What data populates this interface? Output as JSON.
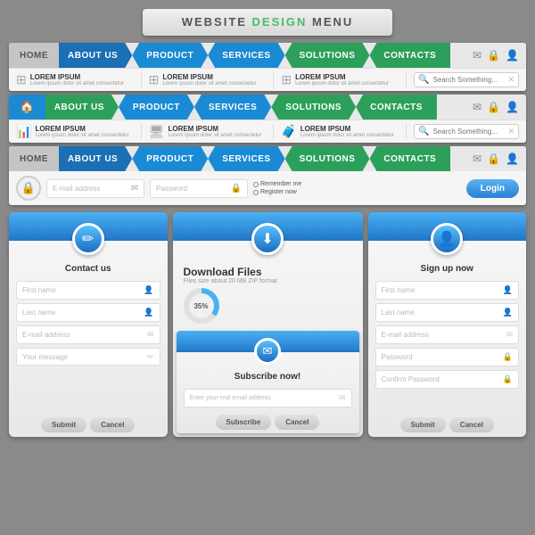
{
  "page": {
    "title_part1": "WEBSITE ",
    "title_part2": "DESIGN",
    "title_part3": " MENU"
  },
  "nav1": {
    "home": "HOME",
    "about": "ABOUT US",
    "product": "PRODUCT",
    "services": "SERVICES",
    "solutions": "SOLUTIONS",
    "contacts": "CONTACTS"
  },
  "nav2": {
    "about": "ABOUT US",
    "product": "PRODUCT",
    "services": "SERVICES",
    "solutions": "SOLUTIONS",
    "contacts": "CONTACTS"
  },
  "nav3": {
    "home": "HOME",
    "about": "ABOUT US",
    "product": "PRODUCT",
    "services": "SERVICES",
    "solutions": "SOLUTIONS",
    "contacts": "CONTACTS"
  },
  "content": {
    "lorem1": "LOREM IPSUM",
    "lorem2": "LOREM IPSUM",
    "lorem3": "LOREM IPSUM",
    "lorem_sub": "Lorem ipsum dolor sit amet consectetur",
    "search_placeholder": "Search Something..."
  },
  "login": {
    "email_placeholder": "E-mail address",
    "password_placeholder": "Password",
    "remember": "Remember me",
    "register": "Register now",
    "btn": "Login"
  },
  "contact_panel": {
    "title": "Contact us",
    "icon": "✏",
    "fields": [
      "First name",
      "Last name",
      "E-mail address",
      "Your message"
    ],
    "submit": "Submit",
    "cancel": "Cancel"
  },
  "download_panel": {
    "title": "Download Files",
    "subtitle": "Files size about 20 MB ZIP format",
    "icon": "⬇",
    "progress": "35%",
    "subscribe_title": "Subscribe now!",
    "subscribe_icon": "✉",
    "email_placeholder": "Enter your real email address",
    "subscribe_btn": "Subscribe",
    "cancel_btn": "Cancel"
  },
  "signup_panel": {
    "title": "Sign up now",
    "icon": "👤",
    "fields": [
      "First name",
      "Last name",
      "E-mail address",
      "Password",
      "Confirm Password"
    ],
    "submit": "Submit",
    "cancel": "Cancel"
  }
}
